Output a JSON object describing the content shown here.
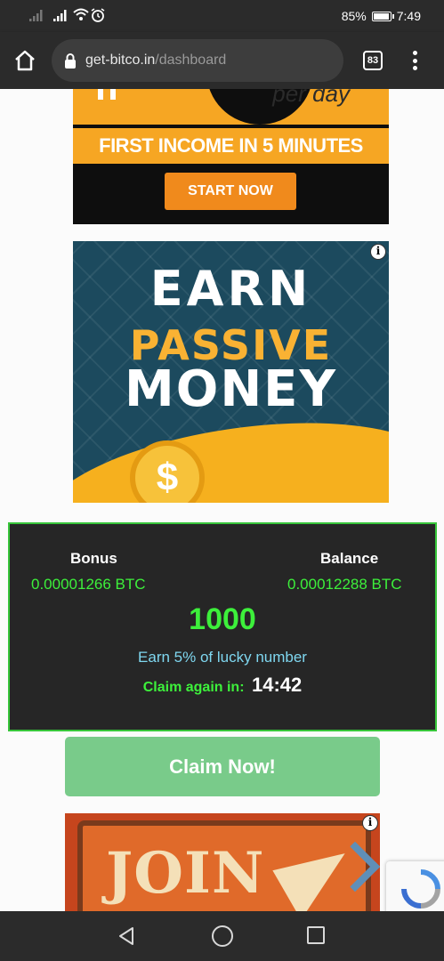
{
  "status_bar": {
    "battery_percent": "85%",
    "battery_level": 0.85,
    "time": "7:49",
    "icons": [
      "signal-icon",
      "signal-icon",
      "wifi-icon",
      "alarm-icon",
      "battery-icon"
    ]
  },
  "browser": {
    "url_host": "get-bitco.in",
    "url_path": "/dashboard",
    "tab_count": "83",
    "icons": [
      "home-icon",
      "lock-icon",
      "tabs-icon",
      "more-vert-icon"
    ]
  },
  "ad_top": {
    "partial_text": "per day",
    "headline": "FIRST INCOME IN 5 MINUTES",
    "button": "START NOW"
  },
  "ad_passive": {
    "line1": "EARN",
    "line2": "PASSIVE",
    "line3": "MONEY",
    "info_glyph": "i"
  },
  "faucet": {
    "bonus_label": "Bonus",
    "bonus_value": "0.00001266 BTC",
    "balance_label": "Balance",
    "balance_value": "0.00012288 BTC",
    "lucky_number": "1000",
    "earn_text": "Earn 5% of lucky number",
    "claim_again_label": "Claim again in:",
    "timer": "14:42",
    "claim_button": "Claim Now!"
  },
  "ad_bottom": {
    "text": "JOIN",
    "info_glyph": "i"
  },
  "colors": {
    "accent_green": "#3df03b",
    "card_bg": "#262626",
    "claim_button": "#79cb8a",
    "earn_text": "#7fd7f0"
  }
}
